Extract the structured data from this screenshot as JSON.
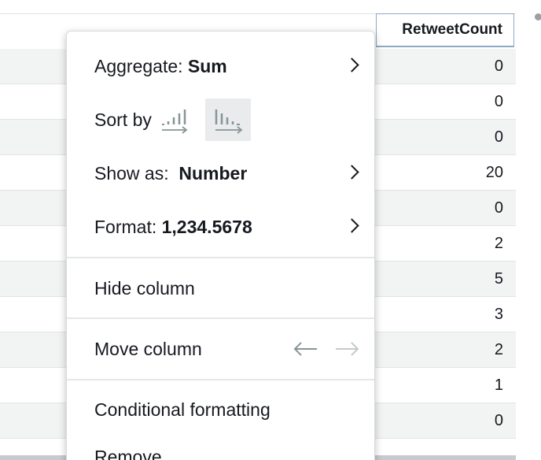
{
  "table": {
    "column_header": "RetweetCount",
    "rows": [
      "0",
      "0",
      "0",
      "20",
      "0",
      "2",
      "5",
      "3",
      "2",
      "1",
      "0"
    ]
  },
  "menu": {
    "aggregate": {
      "label": "Aggregate: ",
      "value": "Sum"
    },
    "sort": {
      "label": "Sort by"
    },
    "show_as": {
      "label": "Show as:  ",
      "value": "Number"
    },
    "format": {
      "label": "Format: ",
      "value": "1,234.5678"
    },
    "hide_column": "Hide column",
    "move_column": "Move column",
    "conditional_formatting": "Conditional formatting",
    "remove": "Remove"
  },
  "colors": {
    "header_border": "#8fa7c4",
    "row_shade": "#f2f3f3",
    "icon_gray": "#879596",
    "active_bg": "#e9ebed"
  },
  "icons": {
    "sort_ascending": "sort-ascending-icon",
    "sort_descending": "sort-descending-icon",
    "move_left": "arrow-left-icon",
    "move_right": "arrow-right-icon",
    "submenu": "chevron-right-icon"
  }
}
